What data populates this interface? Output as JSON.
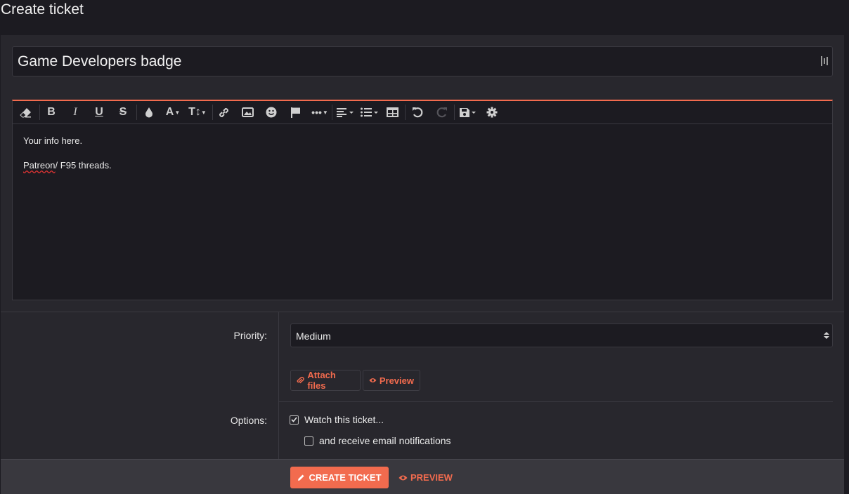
{
  "page": {
    "title": "Create ticket"
  },
  "ticket": {
    "title_value": "Game Developers badge"
  },
  "editor": {
    "toolbar": [
      "eraser-icon",
      "bold-icon",
      "italic-icon",
      "underline-icon",
      "strikethrough-icon",
      "color-icon",
      "font-family-icon",
      "font-size-icon",
      "link-icon",
      "image-icon",
      "smiley-icon",
      "flag-icon",
      "more-icon",
      "align-icon",
      "list-icon",
      "table-icon",
      "undo-icon",
      "redo-icon",
      "save-draft-icon",
      "settings-icon"
    ],
    "line1": "Your info here.",
    "line2_misspelled": "Patreon",
    "line2_rest": "/ F95 threads."
  },
  "priority": {
    "label": "Priority:",
    "value": "Medium"
  },
  "attachments": {
    "attach_label": "Attach files",
    "preview_label": "Preview"
  },
  "options": {
    "label": "Options:",
    "watch_label": "Watch this ticket...",
    "watch_checked": true,
    "email_label": "and receive email notifications",
    "email_checked": false
  },
  "submit": {
    "create_label": "CREATE TICKET",
    "preview_label": "PREVIEW"
  },
  "colors": {
    "accent": "#f26b4e",
    "background": "#1c1b21",
    "panel": "#28272d"
  }
}
